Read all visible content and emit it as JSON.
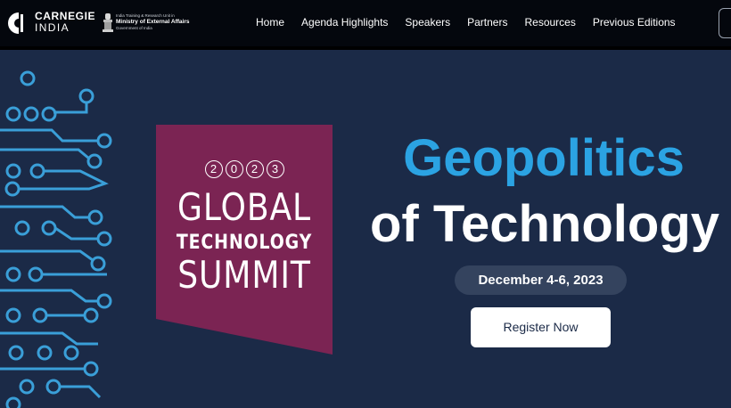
{
  "header": {
    "brand_name": "CARNEGIE",
    "brand_sub": "INDIA",
    "partner_line1": "India Training & Research Unit in",
    "partner_line2": "Ministry of External Affairs",
    "partner_line3": "Government of India",
    "nav": [
      "Home",
      "Agenda Highlights",
      "Speakers",
      "Partners",
      "Resources",
      "Previous Editions"
    ]
  },
  "hero": {
    "badge": {
      "year_digits": [
        "2",
        "0",
        "2",
        "3"
      ],
      "line1": "GLOBAL",
      "line2": "TECHNOLOGY",
      "line3": "SUMMIT"
    },
    "headline_line1": "Geopolitics",
    "headline_line2": "of Technology",
    "dates": "December 4-6, 2023",
    "register_label": "Register Now"
  },
  "colors": {
    "hero_background": "#1b2a47",
    "header_background": "#04070d",
    "badge_magenta": "#7b2453",
    "headline_blue": "#2ba3e3",
    "circuit_blue": "#3a9fd8"
  },
  "icons": {
    "logo": "carnegie-c-logo",
    "emblem": "national-emblem-icon",
    "decoration": "circuit-board-pattern"
  }
}
